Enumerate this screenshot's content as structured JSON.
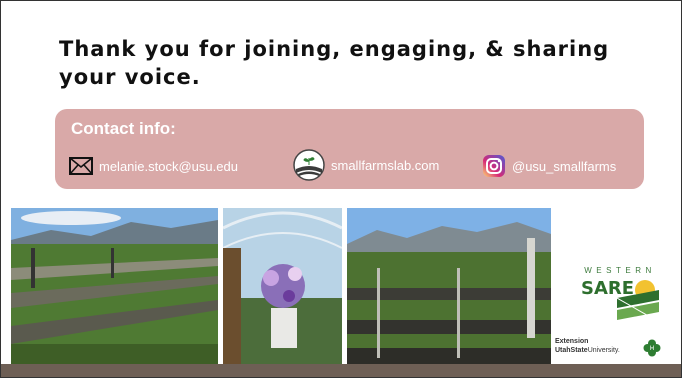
{
  "slide": {
    "title": "Thank you for joining, engaging, & sharing your voice.",
    "contact": {
      "heading": "Contact info:",
      "email": "melanie.stock@usu.edu",
      "website": "smallfarmslab.com",
      "instagram": "@usu_smallfarms"
    },
    "logos": {
      "sare_top": "WESTERN",
      "sare_word": "SARE",
      "extension": "Extension",
      "university_bold": "UtahState",
      "university_rest": "University."
    }
  },
  "colors": {
    "contact_box": "#d9a9a8",
    "title_text": "#111111",
    "footer_bar": "#6e5f55",
    "sare_green": "#2e6f2e",
    "sare_yellow": "#f2c230"
  },
  "icons": [
    "envelope-icon",
    "farm-logo-icon",
    "instagram-icon",
    "four-h-clover-icon"
  ]
}
